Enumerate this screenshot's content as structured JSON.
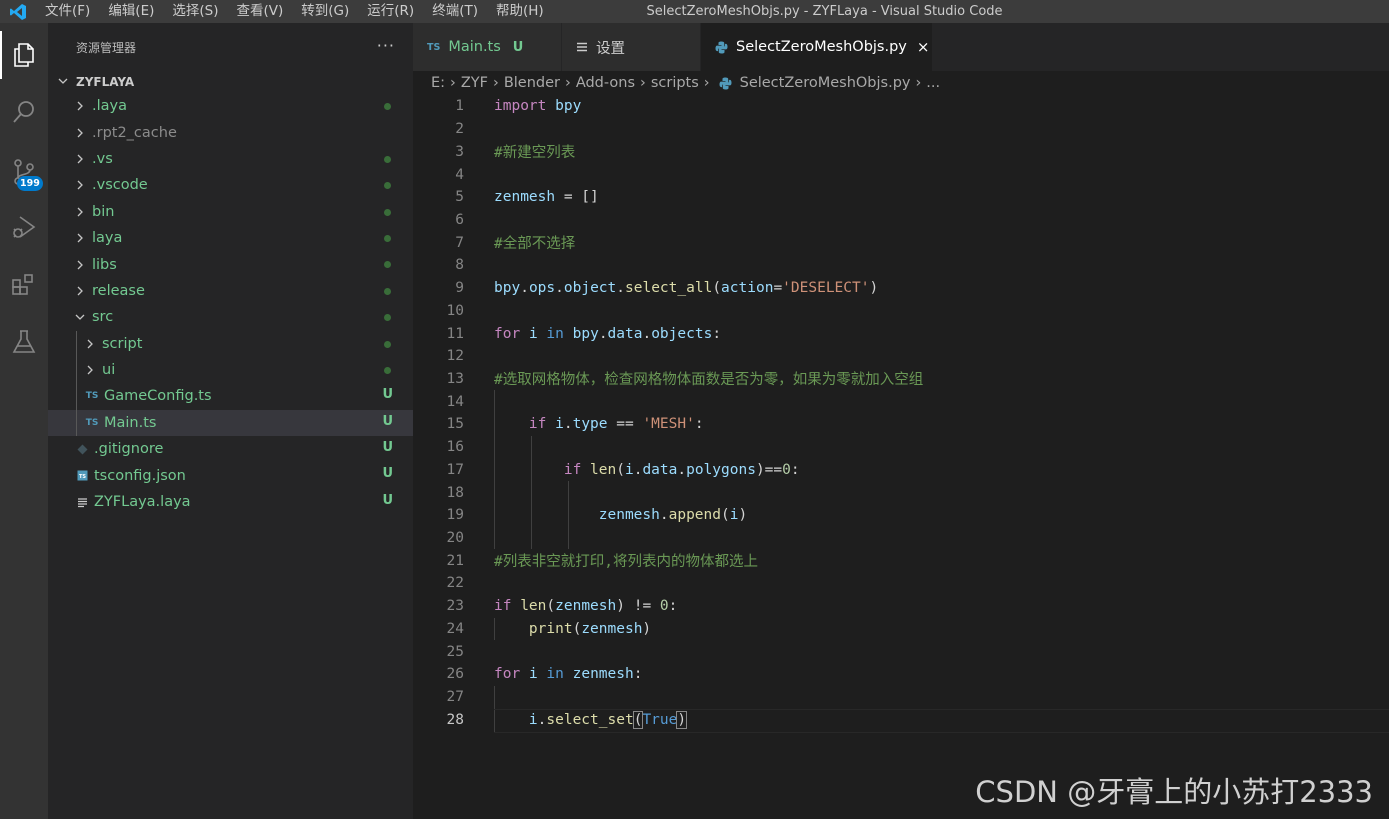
{
  "titlebar": {
    "menu": [
      "文件(F)",
      "编辑(E)",
      "选择(S)",
      "查看(V)",
      "转到(G)",
      "运行(R)",
      "终端(T)",
      "帮助(H)"
    ],
    "window_title": "SelectZeroMeshObjs.py - ZYFLaya - Visual Studio Code"
  },
  "activitybar": {
    "icons": [
      "explorer-icon",
      "search-icon",
      "source-control-icon",
      "run-debug-icon",
      "extensions-icon",
      "testing-icon"
    ],
    "scm_badge": "199"
  },
  "sidebar": {
    "title": "资源管理器",
    "more": "···",
    "folder": "ZYFLAYA",
    "items": [
      {
        "label": ".laya",
        "kind": "folder",
        "status": "dot"
      },
      {
        "label": ".rpt2_cache",
        "kind": "folder",
        "status": ""
      },
      {
        "label": ".vs",
        "kind": "folder",
        "status": "dot"
      },
      {
        "label": ".vscode",
        "kind": "folder",
        "status": "dot"
      },
      {
        "label": "bin",
        "kind": "folder",
        "status": "dot"
      },
      {
        "label": "laya",
        "kind": "folder",
        "status": "dot"
      },
      {
        "label": "libs",
        "kind": "folder",
        "status": "dot"
      },
      {
        "label": "release",
        "kind": "folder",
        "status": "dot"
      },
      {
        "label": "src",
        "kind": "folder-open",
        "status": "dot"
      },
      {
        "label": "script",
        "kind": "folder",
        "status": "dot"
      },
      {
        "label": "ui",
        "kind": "folder",
        "status": "dot"
      },
      {
        "label": "GameConfig.ts",
        "kind": "ts",
        "status": "U"
      },
      {
        "label": "Main.ts",
        "kind": "ts",
        "status": "U"
      },
      {
        "label": ".gitignore",
        "kind": "git",
        "status": "U"
      },
      {
        "label": "tsconfig.json",
        "kind": "tsconfig",
        "status": "U"
      },
      {
        "label": "ZYFLaya.laya",
        "kind": "laya",
        "status": "U"
      }
    ]
  },
  "tabs": [
    {
      "icon": "TS",
      "label": "Main.ts",
      "status": "U"
    },
    {
      "icon": "≡",
      "label": "设置",
      "status": ""
    },
    {
      "icon": "py",
      "label": "SelectZeroMeshObjs.py",
      "status": "×"
    }
  ],
  "breadcrumb": [
    "E:",
    "ZYF",
    "Blender",
    "Add-ons",
    "scripts",
    "SelectZeroMeshObjs.py",
    "..."
  ],
  "code_lines": [
    "1",
    "2",
    "3",
    "4",
    "5",
    "6",
    "7",
    "8",
    "9",
    "10",
    "11",
    "12",
    "13",
    "14",
    "15",
    "16",
    "17",
    "18",
    "19",
    "20",
    "21",
    "22",
    "23",
    "24",
    "25",
    "26",
    "27",
    "28"
  ],
  "code_tokens": {
    "l1": [
      "import",
      "bpy"
    ],
    "l3": "#新建空列表",
    "l5": [
      "zenmesh",
      " = []"
    ],
    "l7": "#全部不选择",
    "l9": [
      "bpy",
      ".",
      "ops",
      ".",
      "object",
      ".",
      "select_all",
      "(",
      "action",
      "=",
      "'DESELECT'",
      ")"
    ],
    "l11": [
      "for",
      "i",
      "in",
      "bpy",
      ".",
      "data",
      ".",
      "objects",
      ":"
    ],
    "l13": "#选取网格物体，检查网格物体面数是否为零，如果为零就加入空组",
    "l15": [
      "if",
      "i",
      ".",
      "type",
      " == ",
      "'MESH'",
      ":"
    ],
    "l17": [
      "if",
      "len",
      "(",
      "i",
      ".",
      "data",
      ".",
      "polygons",
      ")==",
      "0",
      ":"
    ],
    "l19": [
      "zenmesh",
      ".",
      "append",
      "(",
      "i",
      ")"
    ],
    "l21": "#列表非空就打印,将列表内的物体都选上",
    "l23": [
      "if",
      "len",
      "(",
      "zenmesh",
      ") != ",
      "0",
      ":"
    ],
    "l24": [
      "print",
      "(",
      "zenmesh",
      ")"
    ],
    "l26": [
      "for",
      "i",
      "in",
      "zenmesh",
      ":"
    ],
    "l28": [
      "i",
      ".",
      "select_set",
      "(",
      "True",
      ")"
    ]
  },
  "watermark": "CSDN @牙膏上的小苏打2333"
}
